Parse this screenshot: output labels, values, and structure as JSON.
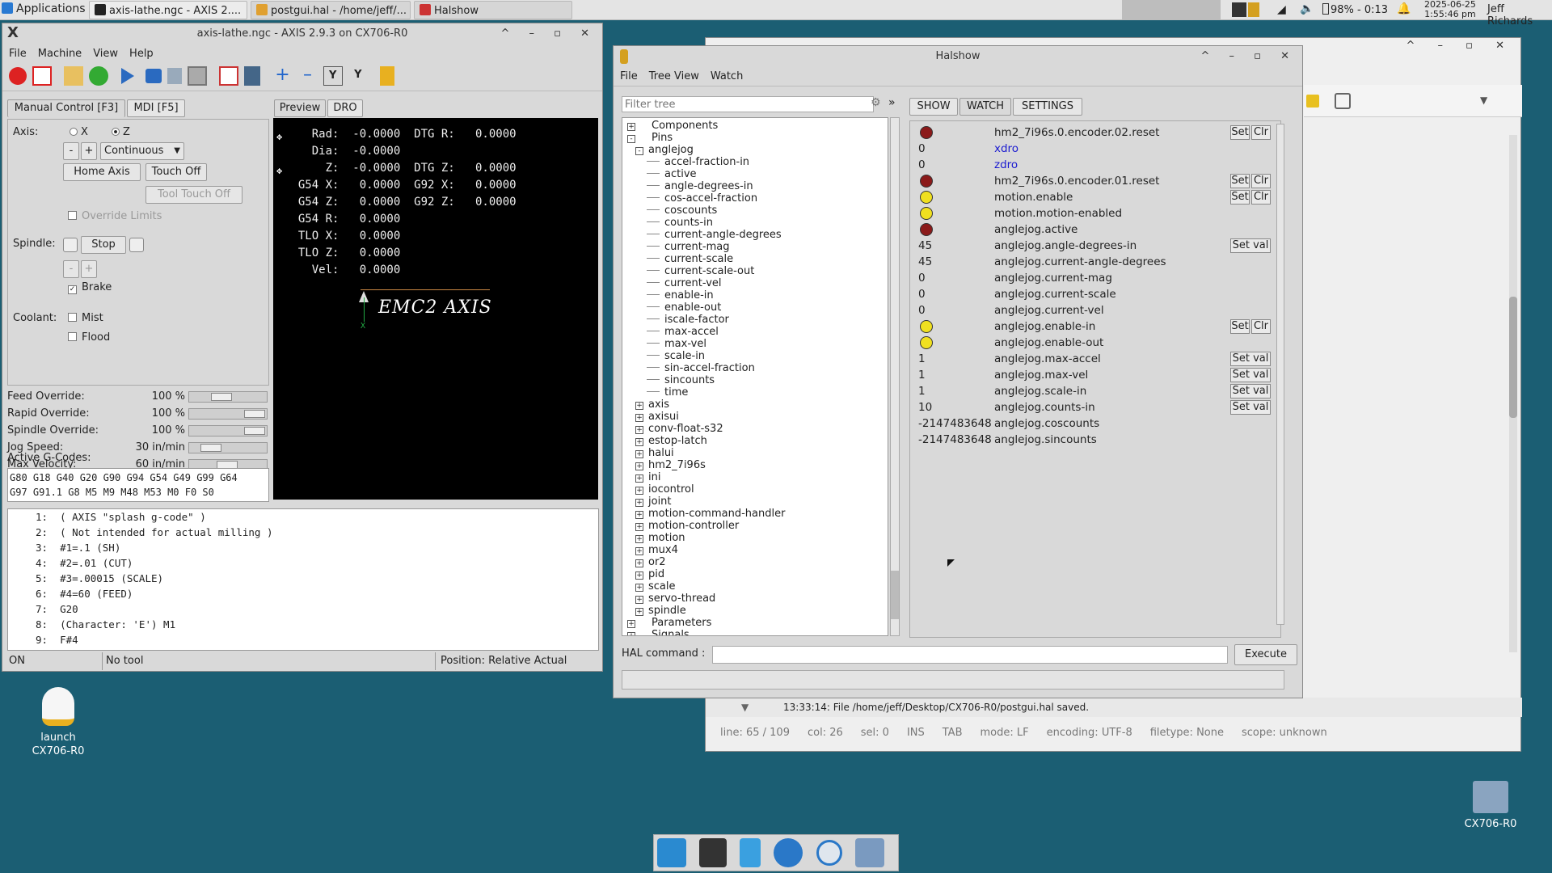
{
  "panel": {
    "apps": "Applications",
    "task1": "axis-lathe.ngc - AXIS 2....",
    "task2": "postgui.hal - /home/jeff/...",
    "task3": "Halshow",
    "battery": "98% - 0:13",
    "date": "2025-06-25",
    "time": "1:55:46 pm",
    "user": "Jeff Richards"
  },
  "axis": {
    "title": "axis-lathe.ngc - AXIS 2.9.3 on CX706-R0",
    "menu": [
      "File",
      "Machine",
      "View",
      "Help"
    ],
    "tabs": [
      "Manual Control [F3]",
      "MDI [F5]"
    ],
    "axis_label": "Axis:",
    "axis_x": "X",
    "axis_z": "Z",
    "minus": "-",
    "plus": "+",
    "jog_mode": "Continuous",
    "home": "Home Axis",
    "touch": "Touch Off",
    "tool_touch": "Tool Touch Off",
    "override": "Override Limits",
    "spindle": "Spindle:",
    "stop": "Stop",
    "brake": "Brake",
    "coolant": "Coolant:",
    "mist": "Mist",
    "flood": "Flood",
    "overrides": [
      {
        "label": "Feed Override:",
        "value": "100 %",
        "pos": 0.4
      },
      {
        "label": "Rapid Override:",
        "value": "100 %",
        "pos": 1
      },
      {
        "label": "Spindle Override:",
        "value": "100 %",
        "pos": 1
      },
      {
        "label": "Jog Speed:",
        "value": "30 in/min",
        "pos": 0.2
      },
      {
        "label": "Max Velocity:",
        "value": "60 in/min",
        "pos": 0.5
      }
    ],
    "gcodes_label": "Active G-Codes:",
    "gcodes1": "G80 G18 G40 G20 G90 G94 G54 G49 G99 G64",
    "gcodes2": "G97 G91.1 G8 M5 M9 M48 M53 M0 F0 S0",
    "preview_tabs": [
      "Preview",
      "DRO"
    ],
    "dro": [
      "    Rad:  -0.0000  DTG R:   0.0000",
      "    Dia:  -0.0000",
      "      Z:  -0.0000  DTG Z:   0.0000",
      "  G54 X:   0.0000  G92 X:   0.0000",
      "  G54 Z:   0.0000  G92 Z:   0.0000",
      "  G54 R:   0.0000",
      "  TLO X:   0.0000",
      "  TLO Z:   0.0000",
      "    Vel:   0.0000"
    ],
    "splash": "EMC2 AXIS",
    "gcode": [
      "1:  ( AXIS \"splash g-code\" )",
      "2:  ( Not intended for actual milling )",
      "3:  #1=.1 (SH)",
      "4:  #2=.01 (CUT)",
      "5:  #3=.00015 (SCALE)",
      "6:  #4=60 (FEED)",
      "7:  G20",
      "8:  (Character: 'E') M1",
      "9:  F#4"
    ],
    "status": {
      "state": "ON",
      "tool": "No tool",
      "position": "Position: Relative Actual"
    }
  },
  "halshow": {
    "title": "Halshow",
    "menu": [
      "File",
      "Tree View",
      "Watch"
    ],
    "filter_placeholder": "Filter tree",
    "tabs": [
      "SHOW",
      "WATCH",
      "SETTINGS"
    ],
    "tree": [
      {
        "t": "Components",
        "lvl": 0,
        "ex": "+"
      },
      {
        "t": "Pins",
        "lvl": 0,
        "ex": "-"
      },
      {
        "t": "anglejog",
        "lvl": 1,
        "ex": "-"
      },
      {
        "t": "accel-fraction-in",
        "lvl": 2
      },
      {
        "t": "active",
        "lvl": 2
      },
      {
        "t": "angle-degrees-in",
        "lvl": 2
      },
      {
        "t": "cos-accel-fraction",
        "lvl": 2
      },
      {
        "t": "coscounts",
        "lvl": 2
      },
      {
        "t": "counts-in",
        "lvl": 2
      },
      {
        "t": "current-angle-degrees",
        "lvl": 2
      },
      {
        "t": "current-mag",
        "lvl": 2
      },
      {
        "t": "current-scale",
        "lvl": 2
      },
      {
        "t": "current-scale-out",
        "lvl": 2
      },
      {
        "t": "current-vel",
        "lvl": 2
      },
      {
        "t": "enable-in",
        "lvl": 2
      },
      {
        "t": "enable-out",
        "lvl": 2
      },
      {
        "t": "iscale-factor",
        "lvl": 2
      },
      {
        "t": "max-accel",
        "lvl": 2
      },
      {
        "t": "max-vel",
        "lvl": 2
      },
      {
        "t": "scale-in",
        "lvl": 2
      },
      {
        "t": "sin-accel-fraction",
        "lvl": 2
      },
      {
        "t": "sincounts",
        "lvl": 2
      },
      {
        "t": "time",
        "lvl": 2
      },
      {
        "t": "axis",
        "lvl": 1,
        "ex": "+"
      },
      {
        "t": "axisui",
        "lvl": 1,
        "ex": "+"
      },
      {
        "t": "conv-float-s32",
        "lvl": 1,
        "ex": "+"
      },
      {
        "t": "estop-latch",
        "lvl": 1,
        "ex": "+"
      },
      {
        "t": "halui",
        "lvl": 1,
        "ex": "+"
      },
      {
        "t": "hm2_7i96s",
        "lvl": 1,
        "ex": "+"
      },
      {
        "t": "ini",
        "lvl": 1,
        "ex": "+"
      },
      {
        "t": "iocontrol",
        "lvl": 1,
        "ex": "+"
      },
      {
        "t": "joint",
        "lvl": 1,
        "ex": "+"
      },
      {
        "t": "motion-command-handler",
        "lvl": 1,
        "ex": "+"
      },
      {
        "t": "motion-controller",
        "lvl": 1,
        "ex": "+"
      },
      {
        "t": "motion",
        "lvl": 1,
        "ex": "+"
      },
      {
        "t": "mux4",
        "lvl": 1,
        "ex": "+"
      },
      {
        "t": "or2",
        "lvl": 1,
        "ex": "+"
      },
      {
        "t": "pid",
        "lvl": 1,
        "ex": "+"
      },
      {
        "t": "scale",
        "lvl": 1,
        "ex": "+"
      },
      {
        "t": "servo-thread",
        "lvl": 1,
        "ex": "+"
      },
      {
        "t": "spindle",
        "lvl": 1,
        "ex": "+"
      },
      {
        "t": "Parameters",
        "lvl": 0,
        "ex": "+"
      },
      {
        "t": "Signals",
        "lvl": 0,
        "ex": "+"
      }
    ],
    "watch": [
      {
        "led": "red",
        "name": "hm2_7i96s.0.encoder.02.reset",
        "btn": "setclr"
      },
      {
        "val": "0",
        "name": "xdro",
        "blue": true
      },
      {
        "val": "0",
        "name": "zdro",
        "blue": true
      },
      {
        "led": "red",
        "name": "hm2_7i96s.0.encoder.01.reset",
        "btn": "setclr"
      },
      {
        "led": "yellow",
        "name": "motion.enable",
        "btn": "setclr"
      },
      {
        "led": "yellow",
        "name": "motion.motion-enabled"
      },
      {
        "led": "red",
        "name": "anglejog.active"
      },
      {
        "val": "45",
        "name": "anglejog.angle-degrees-in",
        "btn": "setval"
      },
      {
        "val": "45",
        "name": "anglejog.current-angle-degrees"
      },
      {
        "val": "0",
        "name": "anglejog.current-mag"
      },
      {
        "val": "0",
        "name": "anglejog.current-scale"
      },
      {
        "val": "0",
        "name": "anglejog.current-vel"
      },
      {
        "led": "yellow",
        "name": "anglejog.enable-in",
        "btn": "setclr"
      },
      {
        "led": "yellow",
        "name": "anglejog.enable-out"
      },
      {
        "val": "1",
        "name": "anglejog.max-accel",
        "btn": "setval"
      },
      {
        "val": "1",
        "name": "anglejog.max-vel",
        "btn": "setval"
      },
      {
        "val": "1",
        "name": "anglejog.scale-in",
        "btn": "setval"
      },
      {
        "val": "10",
        "name": "anglejog.counts-in",
        "btn": "setval"
      },
      {
        "val": "-2147483648",
        "name": "anglejog.coscounts"
      },
      {
        "val": "-2147483648",
        "name": "anglejog.sincounts"
      }
    ],
    "set": "Set",
    "clr": "Clr",
    "setval": "Set val",
    "hal_cmd": "HAL command :",
    "execute": "Execute"
  },
  "editor": {
    "msg": "13:33:14: File /home/jeff/Desktop/CX706-R0/postgui.hal saved.",
    "status": [
      "line: 65 / 109",
      "col: 26",
      "sel: 0",
      "INS",
      "TAB",
      "mode: LF",
      "encoding: UTF-8",
      "filetype: None",
      "scope: unknown"
    ]
  },
  "desktop": {
    "launch": "launch",
    "launch2": "CX706-R0",
    "folder": "CX706-R0"
  }
}
